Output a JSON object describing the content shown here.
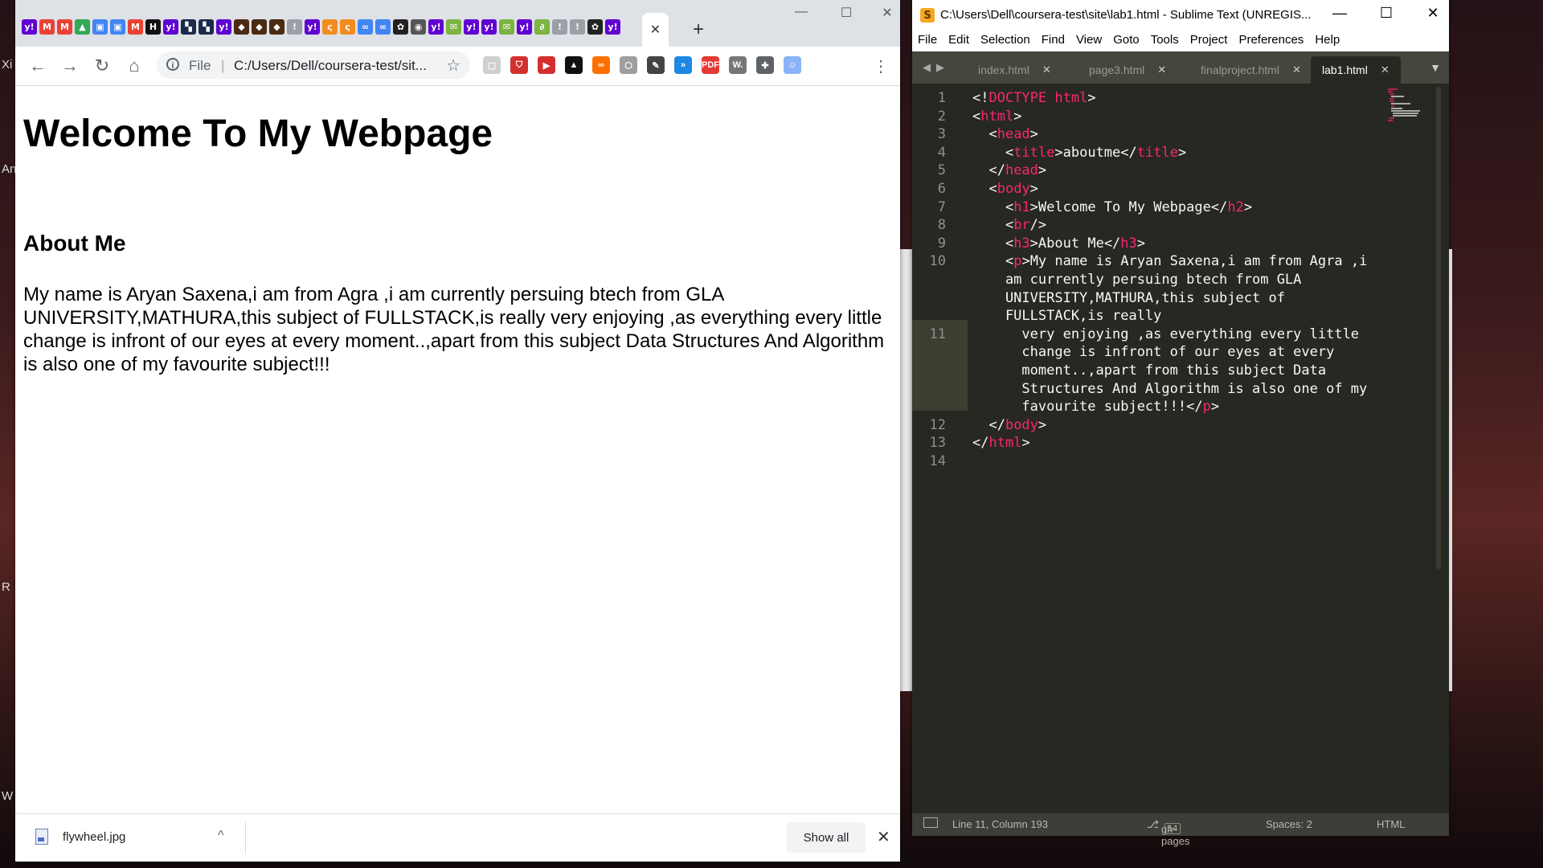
{
  "desktop": {
    "labels": [
      "Xi",
      "An",
      "R",
      "W"
    ]
  },
  "chrome": {
    "tab_favicons": [
      {
        "glyph": "y!",
        "color": "#6001d2"
      },
      {
        "glyph": "M",
        "color": "#ea4335"
      },
      {
        "glyph": "M",
        "color": "#ea4335"
      },
      {
        "glyph": "▲",
        "color": "#34a853"
      },
      {
        "glyph": "▣",
        "color": "#4285f4"
      },
      {
        "glyph": "▣",
        "color": "#4285f4"
      },
      {
        "glyph": "M",
        "color": "#ea4335"
      },
      {
        "glyph": "H",
        "color": "#111111"
      },
      {
        "glyph": "y!",
        "color": "#6001d2"
      },
      {
        "glyph": "▚",
        "color": "#1b2a4a"
      },
      {
        "glyph": "▚",
        "color": "#1b2a4a"
      },
      {
        "glyph": "y!",
        "color": "#6001d2"
      },
      {
        "glyph": "◆",
        "color": "#4a2a12"
      },
      {
        "glyph": "◆",
        "color": "#4a2a12"
      },
      {
        "glyph": "◆",
        "color": "#4a2a12"
      },
      {
        "glyph": "!",
        "color": "#9aa0a6"
      },
      {
        "glyph": "y!",
        "color": "#6001d2"
      },
      {
        "glyph": "ς",
        "color": "#f28b20"
      },
      {
        "glyph": "ς",
        "color": "#f28b20"
      },
      {
        "glyph": "∞",
        "color": "#4285f4"
      },
      {
        "glyph": "∞",
        "color": "#4285f4"
      },
      {
        "glyph": "✿",
        "color": "#222222"
      },
      {
        "glyph": "◉",
        "color": "#555555"
      },
      {
        "glyph": "y!",
        "color": "#6001d2"
      },
      {
        "glyph": "✉",
        "color": "#7cb342"
      },
      {
        "glyph": "y!",
        "color": "#6001d2"
      },
      {
        "glyph": "y!",
        "color": "#6001d2"
      },
      {
        "glyph": "✉",
        "color": "#7cb342"
      },
      {
        "glyph": "y!",
        "color": "#6001d2"
      },
      {
        "glyph": "∂",
        "color": "#7cb342"
      },
      {
        "glyph": "!",
        "color": "#9aa0a6"
      },
      {
        "glyph": "!",
        "color": "#9aa0a6"
      },
      {
        "glyph": "✿",
        "color": "#222222"
      },
      {
        "glyph": "y!",
        "color": "#6001d2"
      }
    ],
    "active_tab_close": "✕",
    "new_tab": "+",
    "window_controls": [
      "—",
      "☐",
      "✕"
    ],
    "nav": {
      "back": "←",
      "forward": "→",
      "reload": "↻",
      "home": "⌂"
    },
    "address": {
      "info": "i",
      "scheme": "File",
      "separator": "|",
      "url": "C:/Users/Dell/coursera-test/sit...",
      "star": "☆"
    },
    "extensions": [
      {
        "glyph": "▢",
        "color": "#cfcfcf"
      },
      {
        "glyph": "⛉",
        "color": "#d32f2f"
      },
      {
        "glyph": "▶",
        "color": "#d32f2f"
      },
      {
        "glyph": "▲",
        "color": "#111111"
      },
      {
        "glyph": "∞",
        "color": "#ff6f00"
      },
      {
        "glyph": "⬡",
        "color": "#9e9e9e"
      },
      {
        "glyph": "✎",
        "color": "#444444"
      },
      {
        "glyph": "»",
        "color": "#1e88e5"
      },
      {
        "glyph": "PDF",
        "color": "#e53935"
      },
      {
        "glyph": "W.",
        "color": "#777777"
      },
      {
        "glyph": "✚",
        "color": "#5f6368"
      },
      {
        "glyph": "☺",
        "color": "#8ab4f8"
      }
    ],
    "menu": "⋮",
    "page": {
      "heading": "Welcome To My Webpage",
      "subheading": "About Me",
      "paragraph": "My name is Aryan Saxena,i am from Agra ,i am currently persuing btech from GLA UNIVERSITY,MATHURA,this subject of FULLSTACK,is really very enjoying ,as everything every little change is infront of our eyes at every moment..,apart from this subject Data Structures And Algorithm is also one of my favourite subject!!!"
    },
    "downloads": {
      "file_name": "flywheel.jpg",
      "chevron": "^",
      "show_all": "Show all",
      "close": "✕"
    }
  },
  "sublime": {
    "title": "C:\\Users\\Dell\\coursera-test\\site\\lab1.html - Sublime Text (UNREGIS...",
    "logo": "S",
    "window_controls": [
      "—",
      "☐",
      "✕"
    ],
    "menu": [
      "File",
      "Edit",
      "Selection",
      "Find",
      "View",
      "Goto",
      "Tools",
      "Project",
      "Preferences",
      "Help"
    ],
    "tab_arrows": [
      "◀",
      "▶"
    ],
    "tabs": [
      {
        "label": "index.html",
        "close": "✕"
      },
      {
        "label": "page3.html",
        "close": "✕"
      },
      {
        "label": "finalproject.html",
        "close": "✕"
      },
      {
        "label": "lab1.html",
        "close": "✕"
      }
    ],
    "tab_dropdown": "▼",
    "lines": [
      {
        "n": "1",
        "segs": [
          [
            "pn",
            "<!"
          ],
          [
            "tg",
            "DOCTYPE"
          ],
          [
            "tx",
            " "
          ],
          [
            "tg",
            "html"
          ],
          [
            "pn",
            ">"
          ]
        ]
      },
      {
        "n": "2",
        "segs": [
          [
            "pn",
            "<"
          ],
          [
            "tg",
            "html"
          ],
          [
            "pn",
            ">"
          ]
        ]
      },
      {
        "n": "3",
        "segs": [
          [
            "pn",
            "  <"
          ],
          [
            "tg",
            "head"
          ],
          [
            "pn",
            ">"
          ]
        ]
      },
      {
        "n": "4",
        "segs": [
          [
            "pn",
            "    <"
          ],
          [
            "tg",
            "title"
          ],
          [
            "pn",
            ">"
          ],
          [
            "tx",
            "aboutme"
          ],
          [
            "pn",
            "</"
          ],
          [
            "tg",
            "title"
          ],
          [
            "pn",
            ">"
          ]
        ]
      },
      {
        "n": "5",
        "segs": [
          [
            "pn",
            "  </"
          ],
          [
            "tg",
            "head"
          ],
          [
            "pn",
            ">"
          ]
        ]
      },
      {
        "n": "6",
        "segs": [
          [
            "pn",
            "  <"
          ],
          [
            "tg",
            "body"
          ],
          [
            "pn",
            ">"
          ]
        ]
      },
      {
        "n": "7",
        "segs": [
          [
            "pn",
            "    <"
          ],
          [
            "tg",
            "h1"
          ],
          [
            "pn",
            ">"
          ],
          [
            "tx",
            "Welcome To My Webpage"
          ],
          [
            "pn",
            "</"
          ],
          [
            "tg",
            "h2"
          ],
          [
            "pn",
            ">"
          ]
        ]
      },
      {
        "n": "8",
        "segs": [
          [
            "pn",
            "    <"
          ],
          [
            "tg",
            "br"
          ],
          [
            "pn",
            "/>"
          ]
        ]
      },
      {
        "n": "9",
        "segs": [
          [
            "pn",
            "    <"
          ],
          [
            "tg",
            "h3"
          ],
          [
            "pn",
            ">"
          ],
          [
            "tx",
            "About Me"
          ],
          [
            "pn",
            "</"
          ],
          [
            "tg",
            "h3"
          ],
          [
            "pn",
            ">"
          ]
        ]
      },
      {
        "n": "10",
        "segs": [
          [
            "pn",
            "    <"
          ],
          [
            "tg",
            "p"
          ],
          [
            "pn",
            ">"
          ],
          [
            "tx",
            "My name is Aryan Saxena,i am from Agra ,i"
          ]
        ]
      },
      {
        "n": "",
        "segs": [
          [
            "tx",
            "    am currently persuing btech from GLA"
          ]
        ]
      },
      {
        "n": "",
        "segs": [
          [
            "tx",
            "    UNIVERSITY,MATHURA,this subject of"
          ]
        ]
      },
      {
        "n": "",
        "segs": [
          [
            "tx",
            "    FULLSTACK,is really"
          ]
        ]
      },
      {
        "n": "11",
        "segs": [
          [
            "tx",
            "      very enjoying ,as everything every little"
          ]
        ]
      },
      {
        "n": "",
        "segs": [
          [
            "tx",
            "      change is infront of our eyes at every"
          ]
        ]
      },
      {
        "n": "",
        "segs": [
          [
            "tx",
            "      moment..,apart from this subject Data"
          ]
        ]
      },
      {
        "n": "",
        "segs": [
          [
            "tx",
            "      Structures And Algorithm is also one of my"
          ]
        ]
      },
      {
        "n": "",
        "segs": [
          [
            "tx",
            "      favourite subject!!!"
          ],
          [
            "pn",
            "</"
          ],
          [
            "tg",
            "p"
          ],
          [
            "pn",
            ">"
          ]
        ]
      },
      {
        "n": "12",
        "segs": [
          [
            "pn",
            "  </"
          ],
          [
            "tg",
            "body"
          ],
          [
            "pn",
            ">"
          ]
        ]
      },
      {
        "n": "13",
        "segs": [
          [
            "pn",
            "</"
          ],
          [
            "tg",
            "html"
          ],
          [
            "pn",
            ">"
          ]
        ]
      },
      {
        "n": "14",
        "segs": []
      }
    ],
    "status": {
      "position": "Line 11, Column 193",
      "branch": "gh-pages",
      "branch_count": "14",
      "spaces": "Spaces: 2",
      "syntax": "HTML"
    }
  }
}
